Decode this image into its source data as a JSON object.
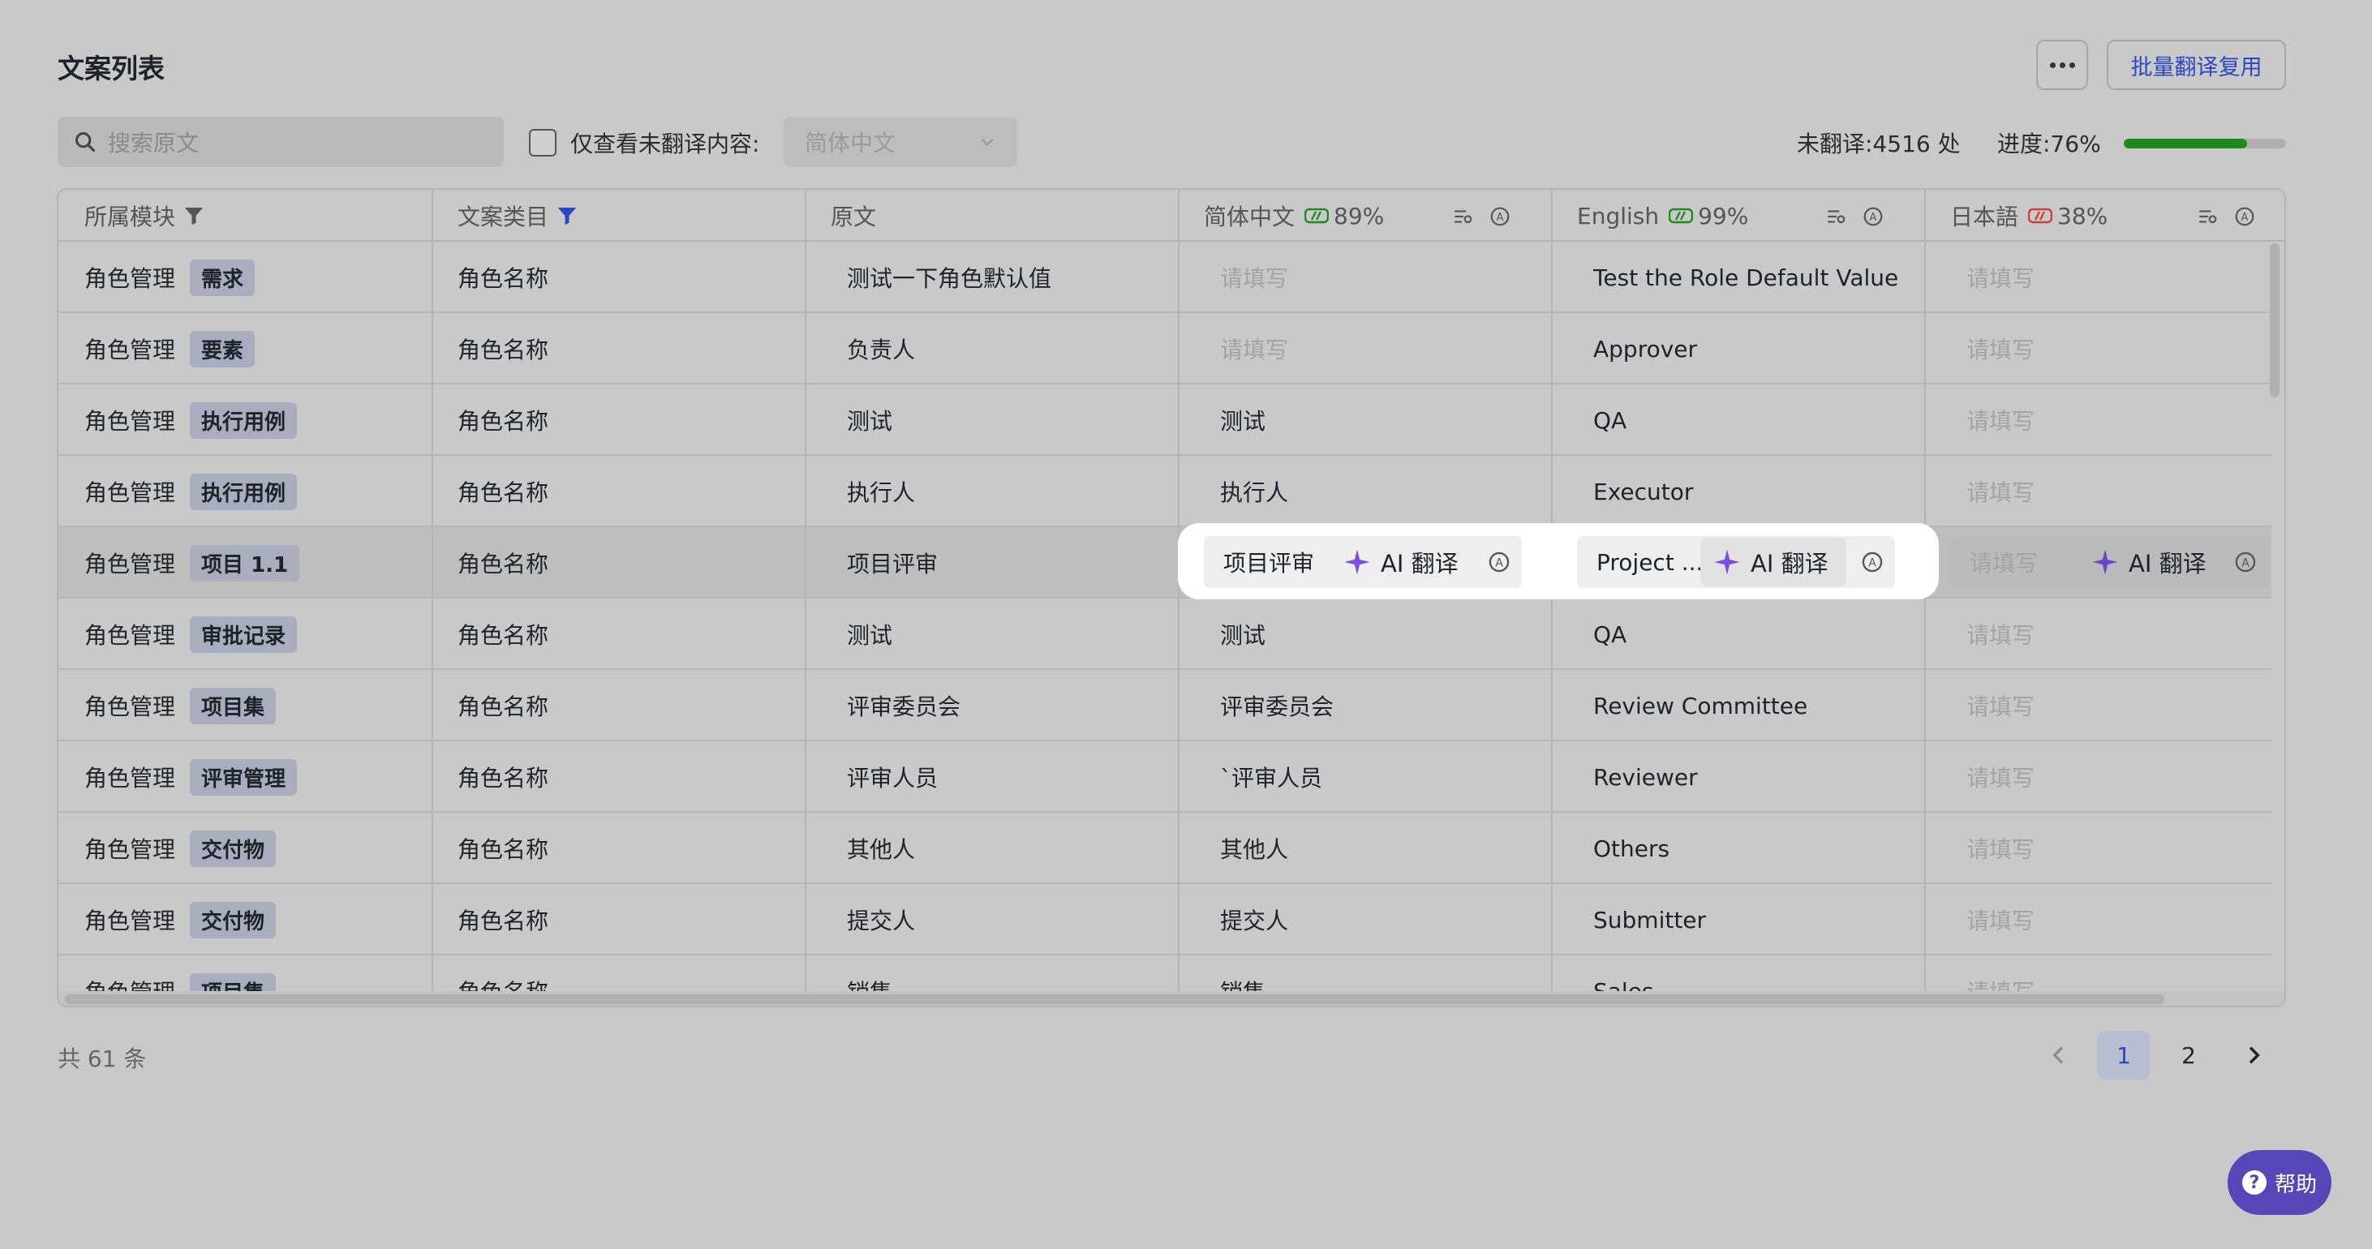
{
  "title": "文案列表",
  "toolbar": {
    "more_label": "…",
    "batch_label": "批量翻译复用"
  },
  "search": {
    "placeholder": "搜索原文"
  },
  "filter": {
    "checkbox_label": "仅查看未翻译内容:",
    "language_value": "简体中文"
  },
  "stats": {
    "untranslated": "未翻译:4516 处",
    "progress_label": "进度:76%",
    "progress_value": 0.76
  },
  "columns": {
    "module": "所属模块",
    "category": "文案类目",
    "source": "原文",
    "zh": {
      "name": "简体中文",
      "percent": "89%"
    },
    "en": {
      "name": "English",
      "percent": "99%"
    },
    "ja": {
      "name": "日本語",
      "percent": "38%"
    }
  },
  "placeholder_text": "请填写",
  "ai_label": "AI 翻译",
  "rows": [
    {
      "module": "角色管理",
      "tag": "需求",
      "category": "角色名称",
      "source": "测试一下角色默认值",
      "zh": "请填写",
      "en": "Test the Role Default Value",
      "ja": "请填写"
    },
    {
      "module": "角色管理",
      "tag": "要素",
      "category": "角色名称",
      "source": "负责人",
      "zh": "请填写",
      "en": "Approver",
      "ja": "请填写"
    },
    {
      "module": "角色管理",
      "tag": "执行用例",
      "category": "角色名称",
      "source": "测试",
      "zh": "测试",
      "en": "QA",
      "ja": "请填写"
    },
    {
      "module": "角色管理",
      "tag": "执行用例",
      "category": "角色名称",
      "source": "执行人",
      "zh": "执行人",
      "en": "Executor",
      "ja": "请填写"
    },
    {
      "module": "角色管理",
      "tag": "项目 1.1",
      "category": "角色名称",
      "source": "项目评审",
      "zh": "项目评审",
      "en": "Project ...",
      "ja": "请填写"
    },
    {
      "module": "角色管理",
      "tag": "审批记录",
      "category": "角色名称",
      "source": "测试",
      "zh": "测试",
      "en": "QA",
      "ja": "请填写"
    },
    {
      "module": "角色管理",
      "tag": "项目集",
      "category": "角色名称",
      "source": "评审委员会",
      "zh": "评审委员会",
      "en": "Review Committee",
      "ja": "请填写"
    },
    {
      "module": "角色管理",
      "tag": "评审管理",
      "category": "角色名称",
      "source": "评审人员",
      "zh": "`评审人员",
      "en": "Reviewer",
      "ja": "请填写"
    },
    {
      "module": "角色管理",
      "tag": "交付物",
      "category": "角色名称",
      "source": "其他人",
      "zh": "其他人",
      "en": "Others",
      "ja": "请填写"
    },
    {
      "module": "角色管理",
      "tag": "交付物",
      "category": "角色名称",
      "source": "提交人",
      "zh": "提交人",
      "en": "Submitter",
      "ja": "请填写"
    },
    {
      "module": "角色管理",
      "tag": "项目集",
      "category": "角色名称",
      "source": "销售",
      "zh": "销售",
      "en": "Sales",
      "ja": "请填写"
    }
  ],
  "footer": {
    "total": "共 61 条",
    "pages": [
      "1",
      "2"
    ],
    "current_page": "1"
  },
  "help": {
    "label": "帮助",
    "icon_glyph": "?"
  },
  "colors": {
    "accent": "#2a48c4",
    "progress": "#1d8a1d",
    "help_bg": "#5646b7",
    "ai_star": "#7b4fe0",
    "zh_badge": "#1d8a1d",
    "en_badge": "#1d8a1d",
    "ja_badge": "#d23b3b"
  }
}
